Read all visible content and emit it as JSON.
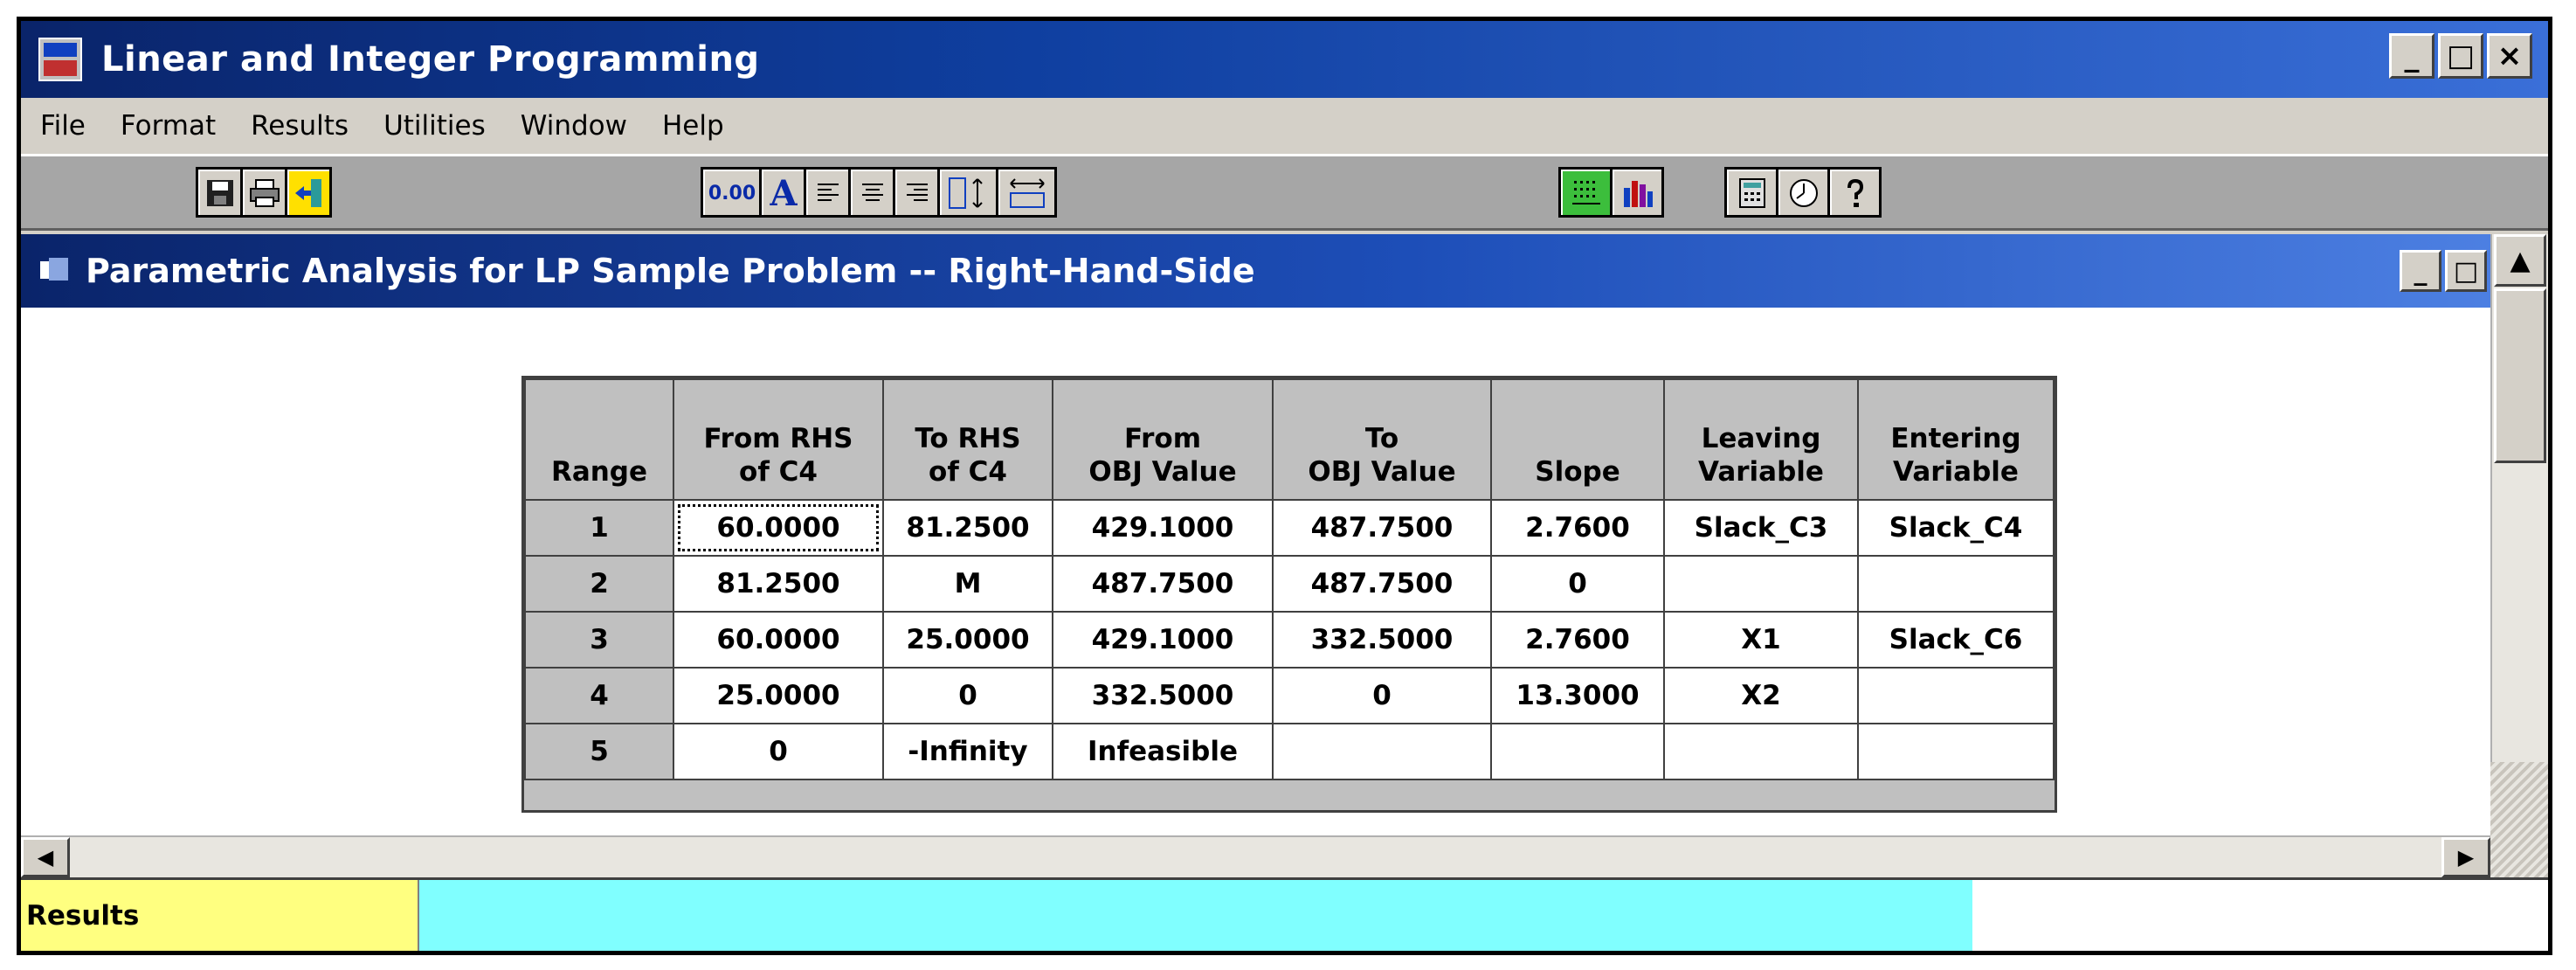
{
  "app": {
    "title": "Linear and Integer Programming",
    "window_buttons": [
      "_",
      "□",
      "×"
    ]
  },
  "menu": [
    "File",
    "Format",
    "Results",
    "Utilities",
    "Window",
    "Help"
  ],
  "toolbar": {
    "group1": [
      "save-icon",
      "print-icon",
      "exit-icon"
    ],
    "group2_labels": {
      "decimal": "0.00",
      "font": "A"
    },
    "group2": [
      "decimal-icon",
      "font-icon",
      "align-left-icon",
      "align-center-icon",
      "align-right-icon",
      "row-height-icon",
      "column-width-icon"
    ],
    "group3": [
      "grid-icon",
      "bar-chart-icon"
    ],
    "group4": [
      "calculator-icon",
      "clock-icon",
      "help-icon"
    ]
  },
  "child_window": {
    "title": "Parametric Analysis for LP Sample Problem -- Right-Hand-Side",
    "buttons": [
      "_",
      "□"
    ]
  },
  "table": {
    "headers": [
      [
        "Range"
      ],
      [
        "From RHS",
        "of C4"
      ],
      [
        "To RHS",
        "of C4"
      ],
      [
        "From",
        "OBJ Value"
      ],
      [
        "To",
        "OBJ Value"
      ],
      [
        "Slope"
      ],
      [
        "Leaving",
        "Variable"
      ],
      [
        "Entering",
        "Variable"
      ]
    ],
    "rows": [
      [
        "1",
        "60.0000",
        "81.2500",
        "429.1000",
        "487.7500",
        "2.7600",
        "Slack_C3",
        "Slack_C4"
      ],
      [
        "2",
        "81.2500",
        "M",
        "487.7500",
        "487.7500",
        "0",
        "",
        ""
      ],
      [
        "3",
        "60.0000",
        "25.0000",
        "429.1000",
        "332.5000",
        "2.7600",
        "X1",
        "Slack_C6"
      ],
      [
        "4",
        "25.0000",
        "0",
        "332.5000",
        "0",
        "13.3000",
        "X2",
        ""
      ],
      [
        "5",
        "0",
        "-Infinity",
        "Infeasible",
        "",
        "",
        "",
        ""
      ]
    ]
  },
  "status": {
    "label": "Results",
    "colors": {
      "label_bg": "#ffff80",
      "progress_bg": "#80ffff"
    }
  },
  "colors": {
    "titlebar_dark": "#0a246a",
    "titlebar_light": "#3a6fd8",
    "toolbar_bg": "#a6a6a6",
    "window_face": "#d4d0c8"
  }
}
